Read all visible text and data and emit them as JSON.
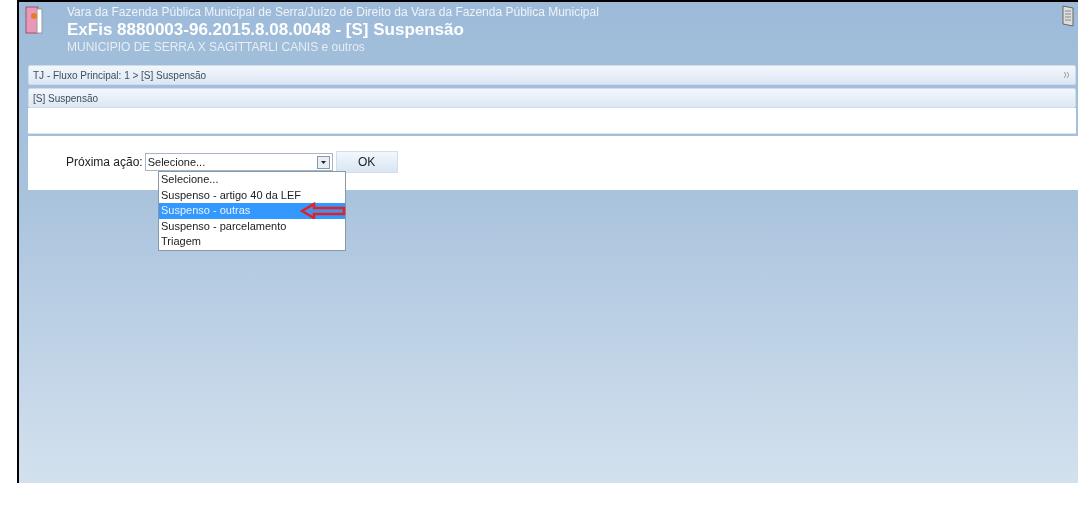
{
  "header": {
    "court": "Vara da Fazenda Pública Municipal de Serra/Juízo de Direito da Vara da Fazenda Pública Municipal",
    "title": "ExFis 8880003-96.2015.8.08.0048 - [S] Suspensão",
    "parties": "MUNICIPIO DE SERRA X SAGITTARLI CANIS e outros"
  },
  "breadcrumb": {
    "text": "TJ - Fluxo Principal: 1 > [S] Suspensão"
  },
  "section_title": "[S] Suspensão",
  "form": {
    "label": "Próxima ação:",
    "select_value": "Selecione...",
    "button": "OK",
    "options": [
      {
        "label": "Selecione...",
        "selected": false
      },
      {
        "label": "Suspenso - artigo 40 da LEF",
        "selected": false
      },
      {
        "label": "Suspenso - outras",
        "selected": true
      },
      {
        "label": "Suspenso - parcelamento",
        "selected": false
      },
      {
        "label": "Triagem",
        "selected": false
      }
    ]
  }
}
